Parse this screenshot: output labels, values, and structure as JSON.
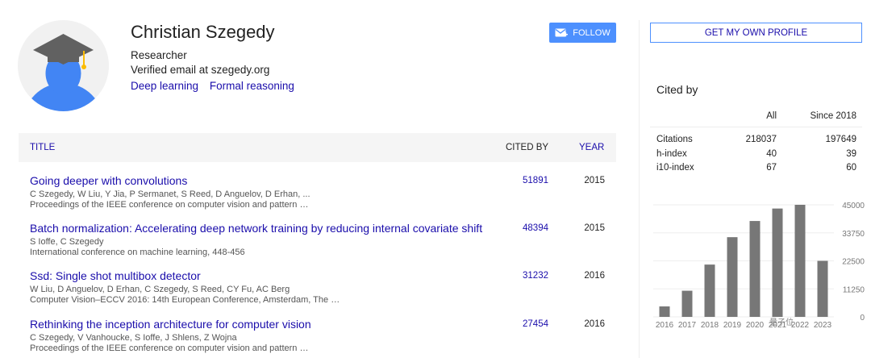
{
  "profile": {
    "name": "Christian Szegedy",
    "affiliation": "Researcher",
    "email": "Verified email at szegedy.org",
    "interests": [
      "Deep learning",
      "Formal reasoning"
    ],
    "follow_label": "FOLLOW",
    "get_profile_label": "GET MY OWN PROFILE"
  },
  "table": {
    "headers": {
      "title": "TITLE",
      "cited_by": "CITED BY",
      "year": "YEAR"
    },
    "rows": [
      {
        "title": "Going deeper with convolutions",
        "authors": "C Szegedy, W Liu, Y Jia, P Sermanet, S Reed, D Anguelov, D Erhan, ...",
        "venue": "Proceedings of the IEEE conference on computer vision and pattern …",
        "cited_by": "51891",
        "year": "2015"
      },
      {
        "title": "Batch normalization: Accelerating deep network training by reducing internal covariate shift",
        "authors": "S Ioffe, C Szegedy",
        "venue": "International conference on machine learning, 448-456",
        "cited_by": "48394",
        "year": "2015"
      },
      {
        "title": "Ssd: Single shot multibox detector",
        "authors": "W Liu, D Anguelov, D Erhan, C Szegedy, S Reed, CY Fu, AC Berg",
        "venue": "Computer Vision–ECCV 2016: 14th European Conference, Amsterdam, The …",
        "cited_by": "31232",
        "year": "2016"
      },
      {
        "title": "Rethinking the inception architecture for computer vision",
        "authors": "C Szegedy, V Vanhoucke, S Ioffe, J Shlens, Z Wojna",
        "venue": "Proceedings of the IEEE conference on computer vision and pattern …",
        "cited_by": "27454",
        "year": "2016"
      }
    ]
  },
  "cited_by": {
    "title": "Cited by",
    "col_all": "All",
    "col_since": "Since 2018",
    "rows": [
      {
        "label": "Citations",
        "all": "218037",
        "since": "197649"
      },
      {
        "label": "h-index",
        "all": "40",
        "since": "39"
      },
      {
        "label": "i10-index",
        "all": "67",
        "since": "60"
      }
    ]
  },
  "chart_data": {
    "type": "bar",
    "categories": [
      "2016",
      "2017",
      "2018",
      "2019",
      "2020",
      "2021",
      "2022",
      "2023"
    ],
    "values": [
      4200,
      10500,
      21000,
      32000,
      38500,
      43500,
      45000,
      22500
    ],
    "yticks": [
      "0",
      "11250",
      "22500",
      "33750",
      "45000"
    ],
    "ylim": [
      0,
      45000
    ],
    "bar_color": "#777777"
  },
  "watermark": "量子位"
}
